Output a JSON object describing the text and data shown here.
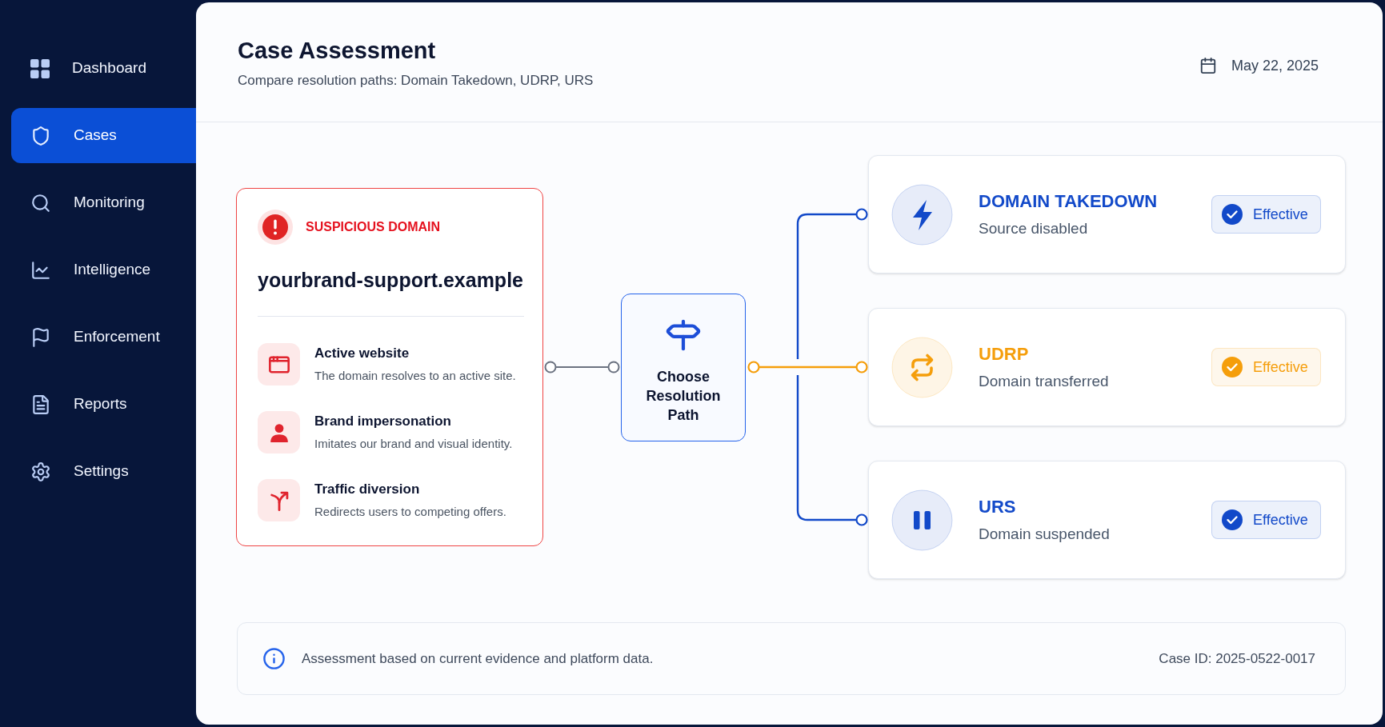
{
  "sidebar": {
    "items": [
      {
        "label": "Dashboard",
        "selected": false
      },
      {
        "label": "Cases",
        "selected": true
      },
      {
        "label": "Monitoring",
        "selected": false
      },
      {
        "label": "Intelligence",
        "selected": false
      },
      {
        "label": "Enforcement",
        "selected": false
      },
      {
        "label": "Reports",
        "selected": false
      },
      {
        "label": "Settings",
        "selected": false
      }
    ]
  },
  "header": {
    "title": "Case Assessment",
    "subtitle": "Compare resolution paths: Domain Takedown, UDRP, URS",
    "date": "May 22, 2025"
  },
  "domain_card": {
    "label": "SUSPICIOUS DOMAIN",
    "domain": "yourbrand-support.example",
    "indicators": [
      {
        "title": "Active website",
        "description": "The domain resolves to an active site."
      },
      {
        "title": "Brand impersonation",
        "description": "Imitates our brand and visual identity."
      },
      {
        "title": "Traffic diversion",
        "description": "Redirects users to competing offers."
      }
    ]
  },
  "decision_node": {
    "label": "Choose Resolution Path"
  },
  "paths": [
    {
      "title": "DOMAIN TAKEDOWN",
      "subtitle": "Source disabled",
      "status": "Effective",
      "color": "#1249c9"
    },
    {
      "title": "UDRP",
      "subtitle": "Domain transferred",
      "status": "Effective",
      "color": "#f59e0b"
    },
    {
      "title": "URS",
      "subtitle": "Domain suspended",
      "status": "Effective",
      "color": "#1249c9"
    }
  ],
  "footer": {
    "note": "Assessment based on current evidence and platform data.",
    "case_id": "Case ID: 2025-0522-0017"
  }
}
